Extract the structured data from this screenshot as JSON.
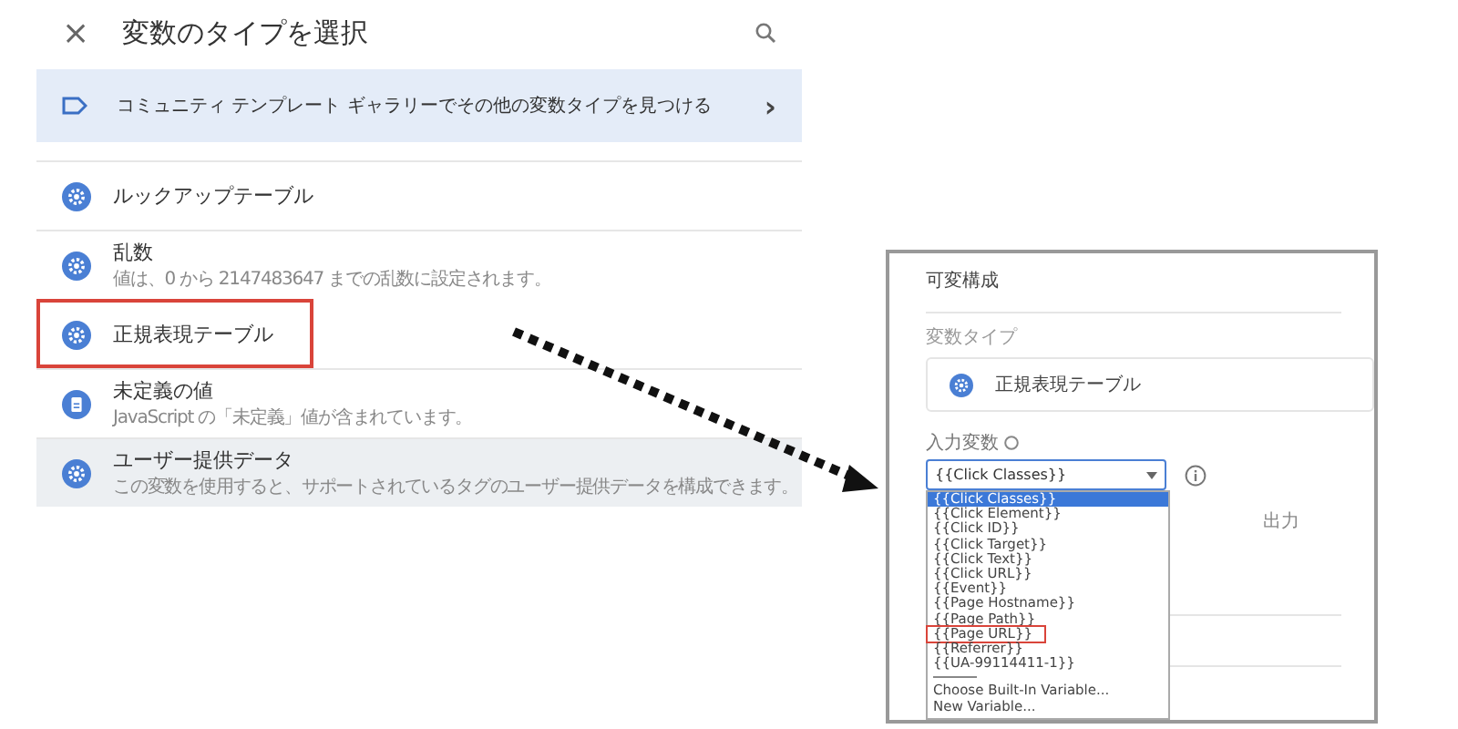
{
  "dialog": {
    "close": "×",
    "title": "変数のタイプを選択"
  },
  "banner": {
    "text": "コミュニティ テンプレート ギャラリーでその他の変数タイプを見つける",
    "chevron": "›"
  },
  "items": [
    {
      "kind": "gear",
      "title": "ルックアップテーブル",
      "selected": false,
      "highlighted": false
    },
    {
      "kind": "gear",
      "title": "乱数",
      "description": "値は、0 から 2147483647 までの乱数に設定されます。",
      "selected": false,
      "highlighted": false
    },
    {
      "kind": "gear",
      "title": "正規表現テーブル",
      "selected": false,
      "highlighted": true
    },
    {
      "kind": "doc",
      "title": "未定義の値",
      "description": "JavaScript の「未定義」値が含まれています。",
      "selected": false,
      "highlighted": false
    },
    {
      "kind": "gear",
      "title": "ユーザー提供データ",
      "description": "この変数を使用すると、サポートされているタグのユーザー提供データを構成できます。",
      "selected": true,
      "highlighted": false
    }
  ],
  "config": {
    "title": "可変構成",
    "type_label": "変数タイプ",
    "type_value": "正規表現テーブル",
    "input_label": "入力変数",
    "select_value": "{{Click Classes}}",
    "output_label": "出力",
    "options": [
      {
        "kind": "option",
        "label": "{{Click Classes}}",
        "selected": true,
        "highlighted": false
      },
      {
        "kind": "option",
        "label": "{{Click Element}}",
        "selected": false,
        "highlighted": false
      },
      {
        "kind": "option",
        "label": "{{Click ID}}",
        "selected": false,
        "highlighted": false
      },
      {
        "kind": "option",
        "label": "{{Click Target}}",
        "selected": false,
        "highlighted": false
      },
      {
        "kind": "option",
        "label": "{{Click Text}}",
        "selected": false,
        "highlighted": false
      },
      {
        "kind": "option",
        "label": "{{Click URL}}",
        "selected": false,
        "highlighted": false
      },
      {
        "kind": "option",
        "label": "{{Event}}",
        "selected": false,
        "highlighted": false
      },
      {
        "kind": "option",
        "label": "{{Page Hostname}}",
        "selected": false,
        "highlighted": false
      },
      {
        "kind": "option",
        "label": "{{Page Path}}",
        "selected": false,
        "highlighted": false
      },
      {
        "kind": "option",
        "label": "{{Page URL}}",
        "selected": false,
        "highlighted": true
      },
      {
        "kind": "option",
        "label": "{{Referrer}}",
        "selected": false,
        "highlighted": false
      },
      {
        "kind": "option",
        "label": "{{UA-99114411-1}}",
        "selected": false,
        "highlighted": false
      },
      {
        "kind": "separator"
      },
      {
        "kind": "option",
        "label": "Choose Built-In Variable...",
        "selected": false,
        "highlighted": false
      },
      {
        "kind": "option",
        "label": "New Variable...",
        "selected": false,
        "highlighted": false
      }
    ]
  }
}
